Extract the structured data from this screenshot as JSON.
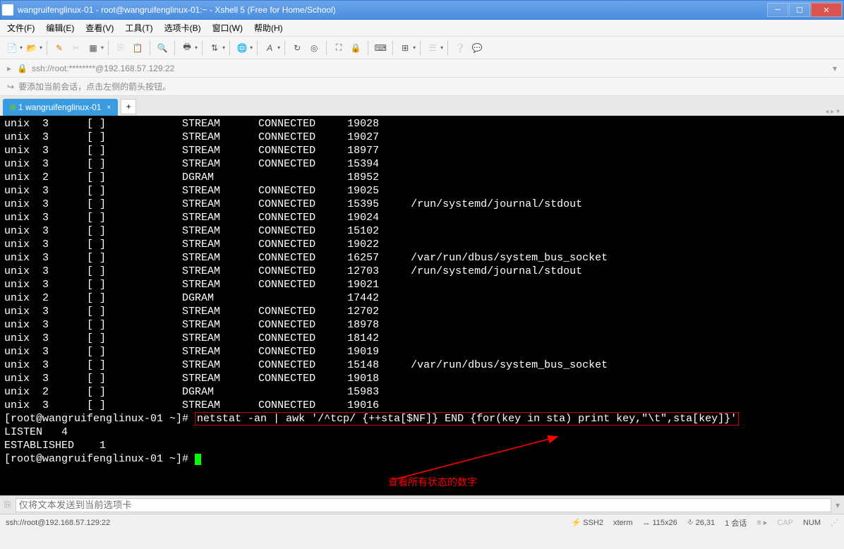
{
  "window": {
    "title": "wangruifenglinux-01 - root@wangruifenglinux-01:~ - Xshell 5 (Free for Home/School)"
  },
  "menu": {
    "file": "文件(F)",
    "edit": "编辑(E)",
    "view": "查看(V)",
    "tools": "工具(T)",
    "tabs": "选项卡(B)",
    "window": "窗口(W)",
    "help": "帮助(H)"
  },
  "addressbar": {
    "url": "ssh://root:********@192.168.57.129:22"
  },
  "hint": {
    "text": "要添加当前会话，点击左侧的箭头按钮。"
  },
  "tab": {
    "label": "1 wangruifenglinux-01",
    "close": "×",
    "new": "+"
  },
  "terminal": {
    "rows": [
      {
        "c1": "unix",
        "c2": "3",
        "c3": "[ ]",
        "c4": "STREAM",
        "c5": "CONNECTED",
        "c6": "19028",
        "c7": ""
      },
      {
        "c1": "unix",
        "c2": "3",
        "c3": "[ ]",
        "c4": "STREAM",
        "c5": "CONNECTED",
        "c6": "19027",
        "c7": ""
      },
      {
        "c1": "unix",
        "c2": "3",
        "c3": "[ ]",
        "c4": "STREAM",
        "c5": "CONNECTED",
        "c6": "18977",
        "c7": ""
      },
      {
        "c1": "unix",
        "c2": "3",
        "c3": "[ ]",
        "c4": "STREAM",
        "c5": "CONNECTED",
        "c6": "15394",
        "c7": ""
      },
      {
        "c1": "unix",
        "c2": "2",
        "c3": "[ ]",
        "c4": "DGRAM",
        "c5": "",
        "c6": "18952",
        "c7": ""
      },
      {
        "c1": "unix",
        "c2": "3",
        "c3": "[ ]",
        "c4": "STREAM",
        "c5": "CONNECTED",
        "c6": "19025",
        "c7": ""
      },
      {
        "c1": "unix",
        "c2": "3",
        "c3": "[ ]",
        "c4": "STREAM",
        "c5": "CONNECTED",
        "c6": "15395",
        "c7": "/run/systemd/journal/stdout"
      },
      {
        "c1": "unix",
        "c2": "3",
        "c3": "[ ]",
        "c4": "STREAM",
        "c5": "CONNECTED",
        "c6": "19024",
        "c7": ""
      },
      {
        "c1": "unix",
        "c2": "3",
        "c3": "[ ]",
        "c4": "STREAM",
        "c5": "CONNECTED",
        "c6": "15102",
        "c7": ""
      },
      {
        "c1": "unix",
        "c2": "3",
        "c3": "[ ]",
        "c4": "STREAM",
        "c5": "CONNECTED",
        "c6": "19022",
        "c7": ""
      },
      {
        "c1": "unix",
        "c2": "3",
        "c3": "[ ]",
        "c4": "STREAM",
        "c5": "CONNECTED",
        "c6": "16257",
        "c7": "/var/run/dbus/system_bus_socket"
      },
      {
        "c1": "unix",
        "c2": "3",
        "c3": "[ ]",
        "c4": "STREAM",
        "c5": "CONNECTED",
        "c6": "12703",
        "c7": "/run/systemd/journal/stdout"
      },
      {
        "c1": "unix",
        "c2": "3",
        "c3": "[ ]",
        "c4": "STREAM",
        "c5": "CONNECTED",
        "c6": "19021",
        "c7": ""
      },
      {
        "c1": "unix",
        "c2": "2",
        "c3": "[ ]",
        "c4": "DGRAM",
        "c5": "",
        "c6": "17442",
        "c7": ""
      },
      {
        "c1": "unix",
        "c2": "3",
        "c3": "[ ]",
        "c4": "STREAM",
        "c5": "CONNECTED",
        "c6": "12702",
        "c7": ""
      },
      {
        "c1": "unix",
        "c2": "3",
        "c3": "[ ]",
        "c4": "STREAM",
        "c5": "CONNECTED",
        "c6": "18978",
        "c7": ""
      },
      {
        "c1": "unix",
        "c2": "3",
        "c3": "[ ]",
        "c4": "STREAM",
        "c5": "CONNECTED",
        "c6": "18142",
        "c7": ""
      },
      {
        "c1": "unix",
        "c2": "3",
        "c3": "[ ]",
        "c4": "STREAM",
        "c5": "CONNECTED",
        "c6": "19019",
        "c7": ""
      },
      {
        "c1": "unix",
        "c2": "3",
        "c3": "[ ]",
        "c4": "STREAM",
        "c5": "CONNECTED",
        "c6": "15148",
        "c7": "/var/run/dbus/system_bus_socket"
      },
      {
        "c1": "unix",
        "c2": "3",
        "c3": "[ ]",
        "c4": "STREAM",
        "c5": "CONNECTED",
        "c6": "19018",
        "c7": ""
      },
      {
        "c1": "unix",
        "c2": "2",
        "c3": "[ ]",
        "c4": "DGRAM",
        "c5": "",
        "c6": "15983",
        "c7": ""
      },
      {
        "c1": "unix",
        "c2": "3",
        "c3": "[ ]",
        "c4": "STREAM",
        "c5": "CONNECTED",
        "c6": "19016",
        "c7": ""
      }
    ],
    "prompt": "[root@wangruifenglinux-01 ~]#",
    "command": "netstat -an | awk '/^tcp/ {++sta[$NF]} END {for(key in sta) print key,\"\\t\",sta[key]}'",
    "result1": "LISTEN   4",
    "result2": "ESTABLISHED    1",
    "annotation": "查看所有状态的数字"
  },
  "sendbar": {
    "placeholder": "仅将文本发送到当前选项卡"
  },
  "statusbar": {
    "left": "ssh://root@192.168.57.129:22",
    "ssh": "SSH2",
    "term": "xterm",
    "size": "115x26",
    "pos": "26,31",
    "sessions": "1 会话",
    "cap": "CAP",
    "num": "NUM"
  }
}
